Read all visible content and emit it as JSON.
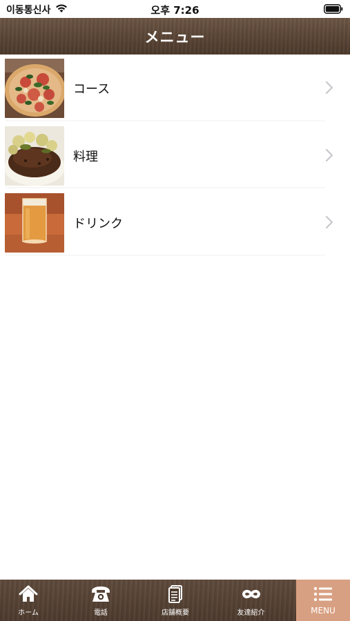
{
  "status_bar": {
    "carrier": "이동통신사",
    "time": "오후 7:26"
  },
  "nav": {
    "title": "メニュー"
  },
  "menu_items": [
    {
      "label": "コース",
      "image": "pizza-photo"
    },
    {
      "label": "料理",
      "image": "stew-photo"
    },
    {
      "label": "ドリンク",
      "image": "beer-photo"
    }
  ],
  "tabs": [
    {
      "label": "ホーム",
      "icon": "home-icon"
    },
    {
      "label": "電話",
      "icon": "phone-icon"
    },
    {
      "label": "店舗概要",
      "icon": "document-icon"
    },
    {
      "label": "友達紹介",
      "icon": "infinity-icon"
    },
    {
      "label": "MENU",
      "icon": "list-icon",
      "active": true
    }
  ],
  "colors": {
    "nav_brown": "#5a4535",
    "active_tab": "#d8a082",
    "chevron": "#c7c7cc"
  }
}
